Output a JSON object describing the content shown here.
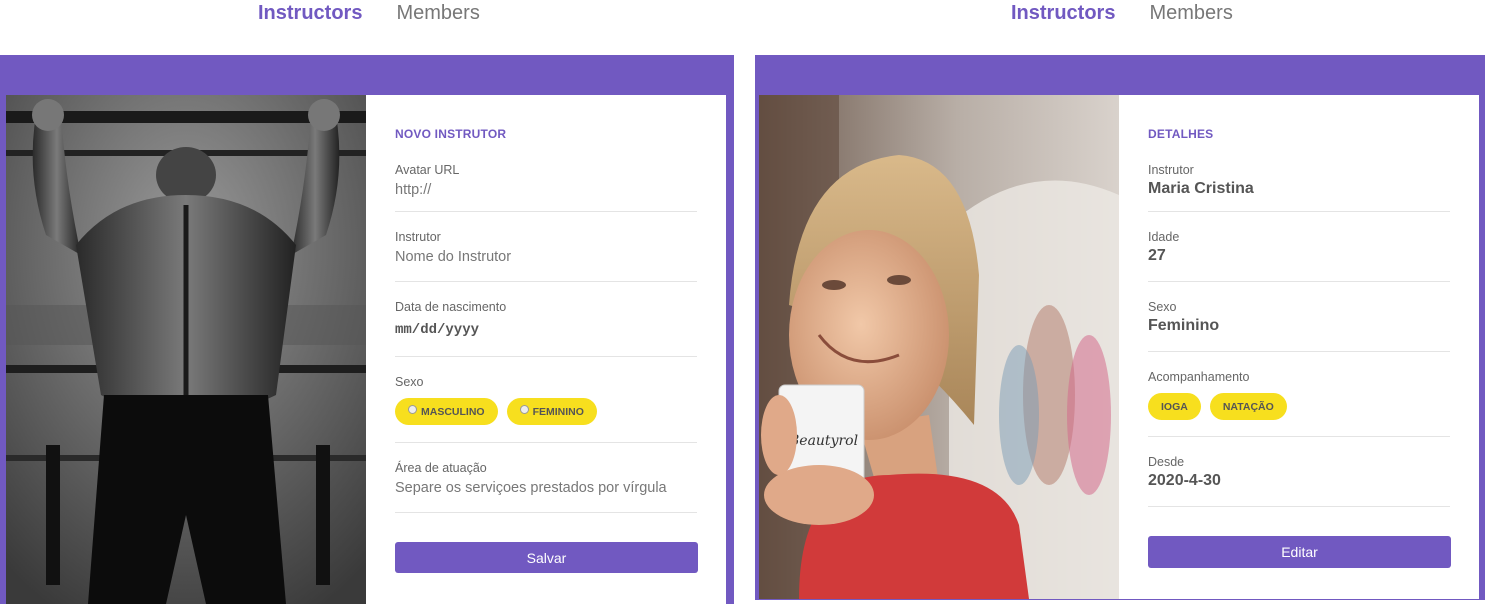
{
  "nav": {
    "instructors": "Instructors",
    "members": "Members"
  },
  "left": {
    "section_title": "NOVO INSTRUTOR",
    "fields": [
      {
        "label": "Avatar URL",
        "placeholder": "http://"
      },
      {
        "label": "Instrutor",
        "placeholder": "Nome do Instrutor"
      },
      {
        "label": "Data de nascimento",
        "placeholder": "mm/dd/yyyy"
      },
      {
        "label": "Sexo"
      },
      {
        "label": "Área de atuação",
        "placeholder": "Separe os serviçoes prestados por vírgula"
      }
    ],
    "gender_options": [
      "MASCULINO",
      "FEMININO"
    ],
    "save_label": "Salvar"
  },
  "right": {
    "section_title": "DETALHES",
    "fields": [
      {
        "label": "Instrutor",
        "value": "Maria Cristina"
      },
      {
        "label": "Idade",
        "value": "27"
      },
      {
        "label": "Sexo",
        "value": "Feminino"
      },
      {
        "label": "Acompanhamento"
      },
      {
        "label": "Desde",
        "value": "2020-4-30"
      }
    ],
    "services": [
      "IOGA",
      "NATAÇÃO"
    ],
    "mug_text": "Beautyrol",
    "edit_label": "Editar"
  },
  "colors": {
    "accent": "#7159c1",
    "chip": "#f7df1e"
  }
}
